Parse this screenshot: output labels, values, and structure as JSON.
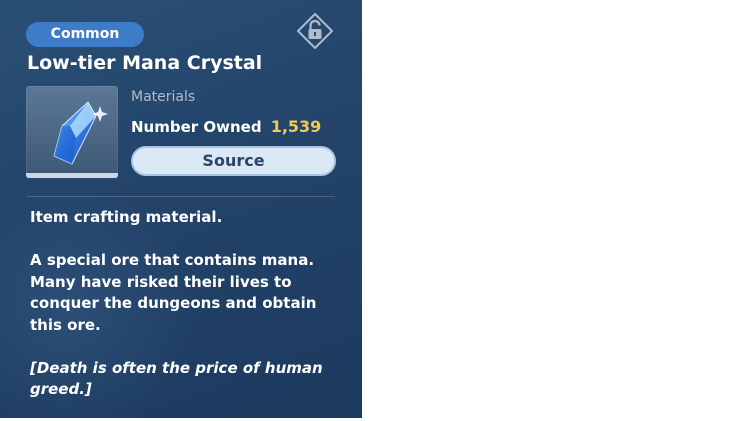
{
  "item": {
    "rarity": "Common",
    "name": "Low-tier Mana Crystal",
    "category": "Materials",
    "owned_label": "Number Owned",
    "owned_count": "1,539",
    "source_button": "Source",
    "icon": "mana-crystal-icon",
    "lock_icon": "unlocked-padlock-icon"
  },
  "description": {
    "line1": "Item crafting material.",
    "paragraph": "A special ore that contains mana. Many have risked their lives to conquer the dungeons and obtain this ore.",
    "quote": "[Death is often the price of human greed.]"
  },
  "colors": {
    "panel": "#234369",
    "rarity_badge": "#3f7cc7",
    "owned_count": "#f2c85b",
    "source_button": "#dbe8f6"
  }
}
